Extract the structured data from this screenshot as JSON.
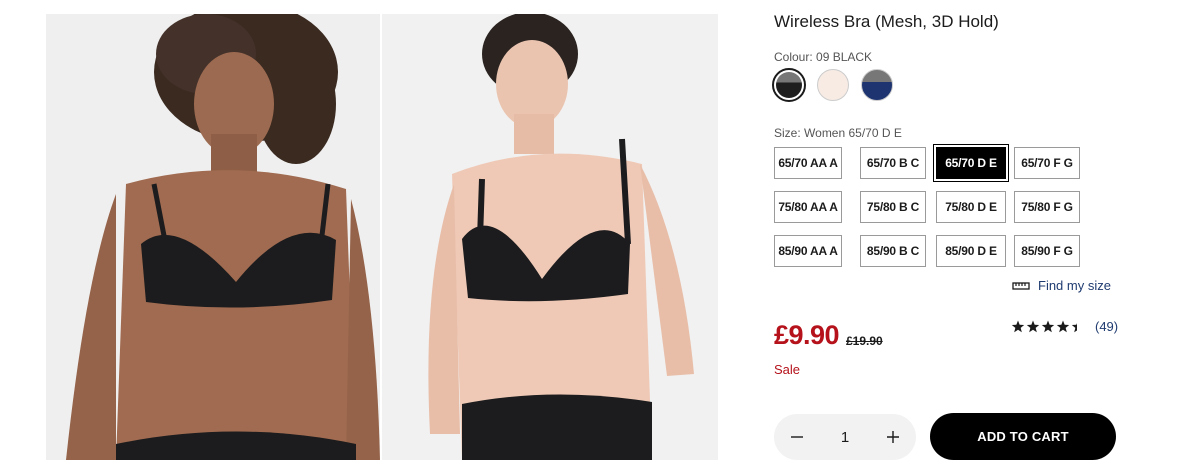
{
  "product": {
    "title": "Wireless Bra (Mesh, 3D Hold)",
    "colour_label": "Colour:",
    "colour_selected": "09 BLACK",
    "colours": [
      {
        "name": "black",
        "hex": "#1e1e1e",
        "selected": true
      },
      {
        "name": "beige",
        "hex": "#f7ebe4",
        "selected": false
      },
      {
        "name": "navy",
        "hex": "#1e3470",
        "selected": false
      }
    ],
    "size_label": "Size:",
    "size_selected": "Women 65/70 D E",
    "sizes": [
      {
        "label": "65/70 AA A",
        "selected": false
      },
      {
        "label": "65/70 B C",
        "selected": false
      },
      {
        "label": "65/70 D E",
        "selected": true
      },
      {
        "label": "65/70 F G",
        "selected": false
      },
      {
        "label": "75/80 AA A",
        "selected": false
      },
      {
        "label": "75/80 B C",
        "selected": false
      },
      {
        "label": "75/80 D E",
        "selected": false
      },
      {
        "label": "75/80 F G",
        "selected": false
      },
      {
        "label": "85/90 AA A",
        "selected": false
      },
      {
        "label": "85/90 B C",
        "selected": false
      },
      {
        "label": "85/90 D E",
        "selected": false
      },
      {
        "label": "85/90 F G",
        "selected": false
      }
    ],
    "find_size": {
      "label": "Find my size",
      "icon": "ruler-icon"
    },
    "price": "£9.90",
    "old_price": "£19.90",
    "sale": "Sale",
    "rating": {
      "stars": 4.5,
      "count": "(49)"
    },
    "quantity": "1",
    "add_to_cart": "ADD TO CART"
  },
  "images": [
    {
      "name": "model-photo-front",
      "bra_color": "#1c1c1e"
    },
    {
      "name": "model-photo-second",
      "bra_color": "#1c1c1e"
    }
  ],
  "colors": {
    "price_red": "#b5121b",
    "link_blue": "#1f3b70",
    "button_black": "#000000"
  }
}
